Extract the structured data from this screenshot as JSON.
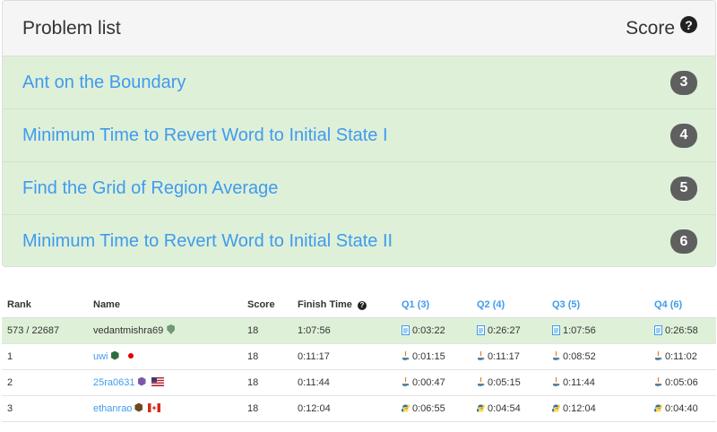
{
  "problem_list": {
    "title": "Problem list",
    "score_label": "Score",
    "help_glyph": "?",
    "problems": [
      {
        "name": "Ant on the Boundary",
        "score": "3"
      },
      {
        "name": "Minimum Time to Revert Word to Initial State I",
        "score": "4"
      },
      {
        "name": "Find the Grid of Region Average",
        "score": "5"
      },
      {
        "name": "Minimum Time to Revert Word to Initial State II",
        "score": "6"
      }
    ]
  },
  "ranking": {
    "headers": {
      "rank": "Rank",
      "name": "Name",
      "score": "Score",
      "finish_time": "Finish Time",
      "q1": "Q1 (3)",
      "q2": "Q2 (4)",
      "q3": "Q3 (5)",
      "q4": "Q4 (6)"
    },
    "rows": [
      {
        "rank": "573 / 22687",
        "name": "vedantmishra69",
        "score": "18",
        "finish": "1:07:56",
        "q1": "0:03:22",
        "q2": "0:26:27",
        "q3": "1:07:56",
        "q4": "0:26:58"
      },
      {
        "rank": "1",
        "name": "uwi",
        "score": "18",
        "finish": "0:11:17",
        "q1": "0:01:15",
        "q2": "0:11:17",
        "q3": "0:08:52",
        "q4": "0:11:02"
      },
      {
        "rank": "2",
        "name": "25ra0631",
        "score": "18",
        "finish": "0:11:44",
        "q1": "0:00:47",
        "q2": "0:05:15",
        "q3": "0:11:44",
        "q4": "0:05:06"
      },
      {
        "rank": "3",
        "name": "ethanrao",
        "score": "18",
        "finish": "0:12:04",
        "q1": "0:06:55",
        "q2": "0:04:54",
        "q3": "0:12:04",
        "q4": "0:04:40"
      }
    ]
  },
  "colors": {
    "accent": "#3f9bee",
    "row_success": "#dff0d8",
    "badge": "#5f5f5f"
  },
  "icons": {
    "self_language": "document-icon",
    "uwi_language": "java-icon",
    "25ra0631_language": "java-icon",
    "ethanrao_language": "python-icon"
  }
}
